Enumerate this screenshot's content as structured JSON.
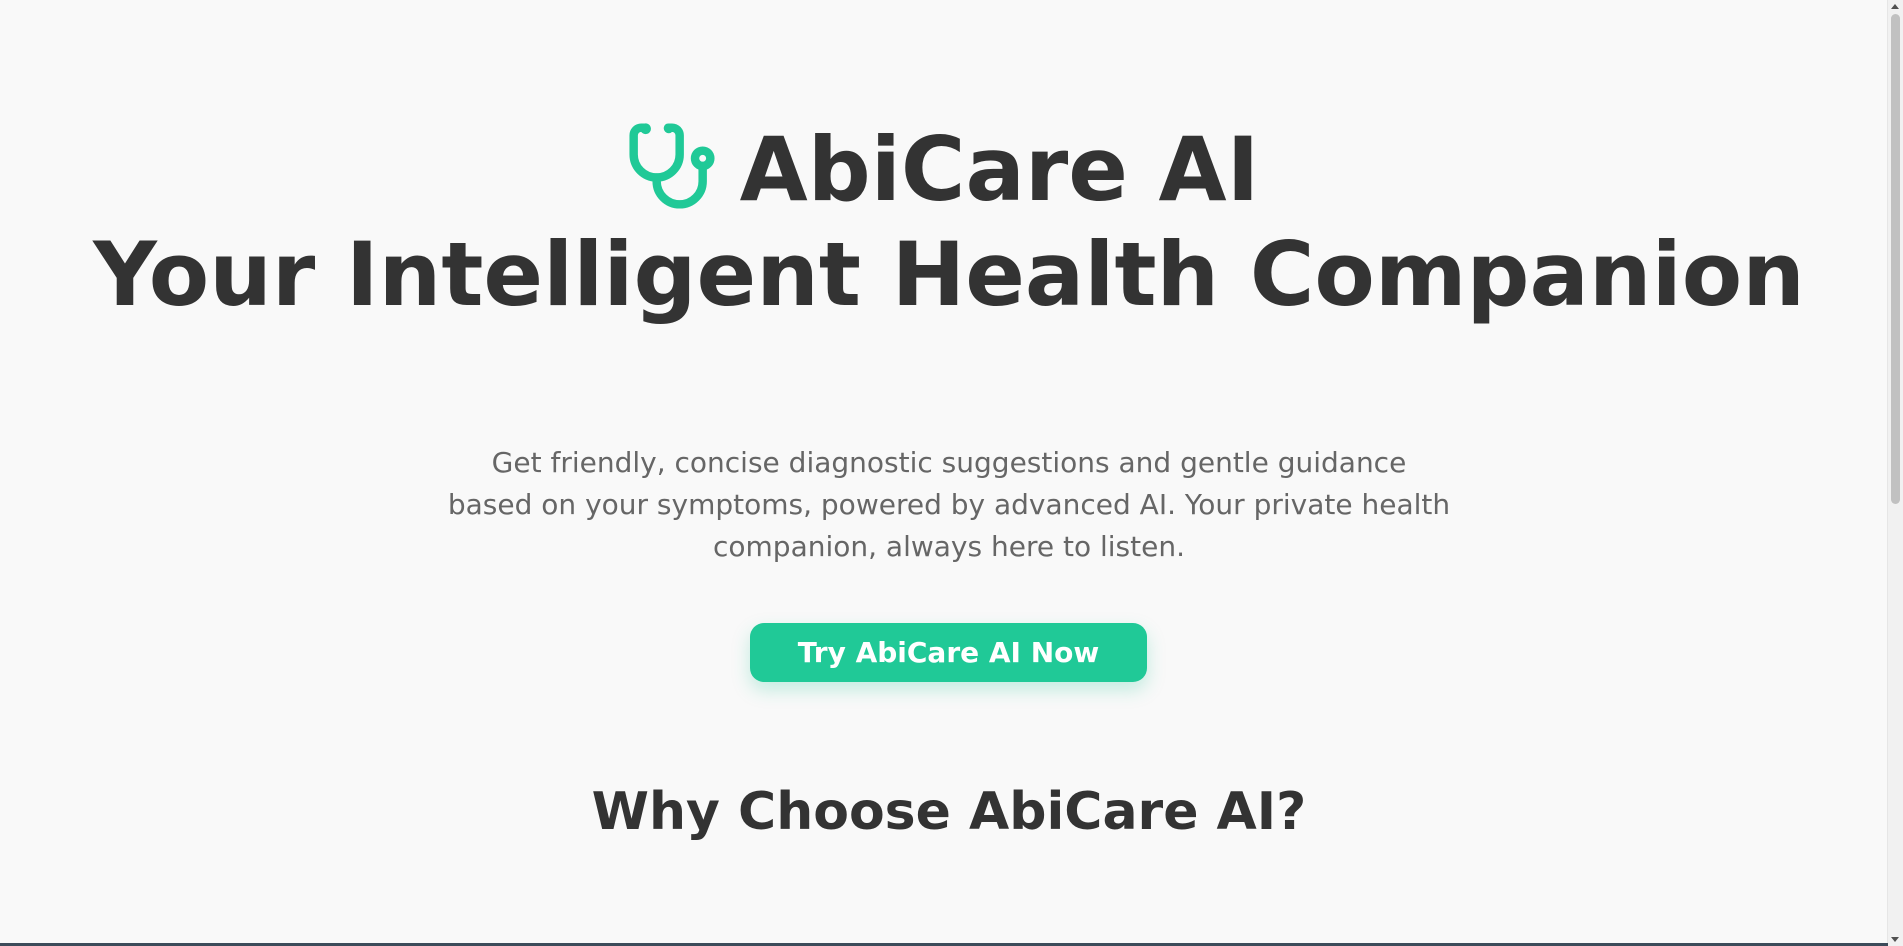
{
  "brand": {
    "name": "AbiCare AI",
    "icon": "stethoscope-icon",
    "accent_color": "#20c997"
  },
  "hero": {
    "headline": "Your Intelligent Health Companion",
    "subtitle": "Get friendly, concise diagnostic suggestions and gentle guidance based on your symptoms, powered by advanced AI. Your private health companion, always here to listen.",
    "cta_label": "Try AbiCare AI Now"
  },
  "features": {
    "section_title": "Why Choose AbiCare AI?"
  },
  "colors": {
    "background": "#f9f9f9",
    "text_primary": "#333333",
    "text_secondary": "#666666",
    "button": "#20c997",
    "button_text": "#ffffff"
  }
}
